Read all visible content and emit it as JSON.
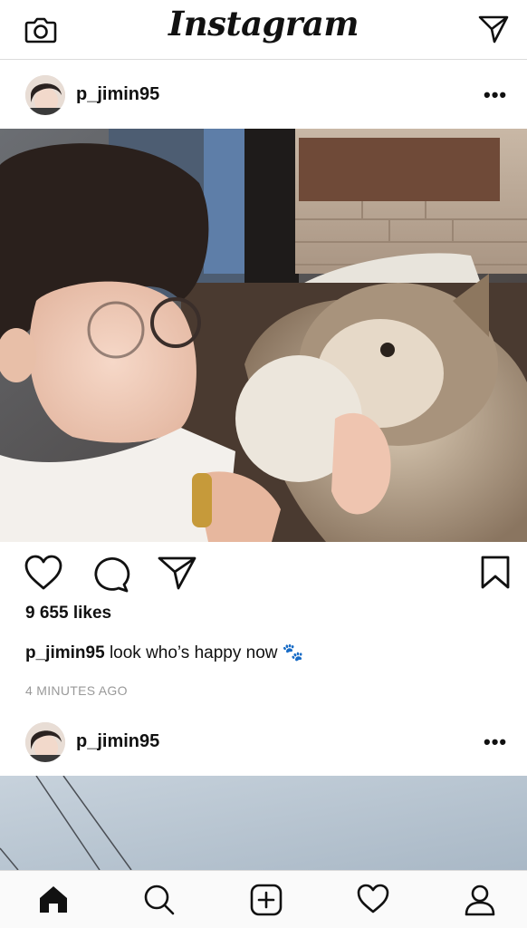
{
  "app": {
    "logo_text": "Instagram"
  },
  "top_bar": {
    "left_icon": "camera-icon",
    "right_icon": "direct-message-icon"
  },
  "posts": [
    {
      "username": "p_jimin95",
      "more_label": "•••",
      "likes_text": "9 655 likes",
      "caption_user": "p_jimin95",
      "caption_text": "look who’s happy now 🐾",
      "time_ago": "4 MINUTES AGO",
      "actions": [
        "heart-icon",
        "comment-icon",
        "share-icon",
        "bookmark-icon"
      ]
    },
    {
      "username": "p_jimin95",
      "more_label": "•••"
    }
  ],
  "tab_bar": {
    "items": [
      "home-icon",
      "search-icon",
      "new-post-icon",
      "activity-heart-icon",
      "profile-icon"
    ],
    "active": "home-icon"
  }
}
